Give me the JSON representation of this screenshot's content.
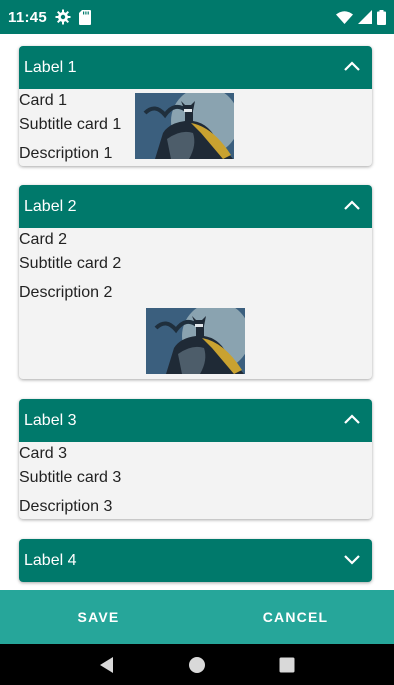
{
  "status_bar": {
    "time": "11:45",
    "icons": [
      "gear-icon",
      "sd-card-icon",
      "wifi-icon",
      "signal-icon",
      "battery-icon"
    ]
  },
  "panels": [
    {
      "label": "Label 1",
      "expanded": true,
      "card": {
        "title": "Card 1",
        "subtitle": "Subtitle card 1",
        "description": "Description 1",
        "image": "batman-image"
      }
    },
    {
      "label": "Label 2",
      "expanded": true,
      "card": {
        "title": "Card 2",
        "subtitle": "Subtitle card 2",
        "description": "Description 2",
        "image": "batman-image"
      }
    },
    {
      "label": "Label 3",
      "expanded": true,
      "card": {
        "title": "Card 3",
        "subtitle": "Subtitle card 3",
        "description": "Description 3"
      }
    },
    {
      "label": "Label 4",
      "expanded": false
    }
  ],
  "actions": {
    "save_label": "SAVE",
    "cancel_label": "CANCEL"
  },
  "nav": {
    "icons": [
      "back-icon",
      "home-icon",
      "recents-icon"
    ]
  },
  "colors": {
    "primary_dark": "#00796b",
    "accent_bar": "#26a69a",
    "card_bg": "#f3f3f3"
  }
}
